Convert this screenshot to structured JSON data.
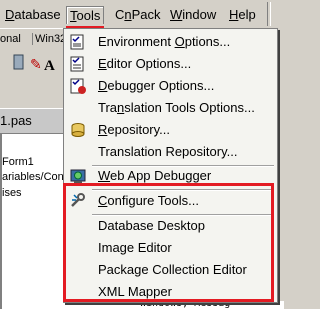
{
  "menubar": {
    "items": [
      {
        "label": "Database",
        "pre": "",
        "u": "D",
        "post": "atabase"
      },
      {
        "label": "Tools",
        "pre": "",
        "u": "T",
        "post": "ools"
      },
      {
        "label": "CnPack",
        "pre": "C",
        "u": "n",
        "post": "Pack"
      },
      {
        "label": "Window",
        "pre": "",
        "u": "W",
        "post": "indow"
      },
      {
        "label": "Help",
        "pre": "",
        "u": "H",
        "post": "elp"
      }
    ]
  },
  "background": {
    "tabs": [
      "onal",
      "Win32"
    ],
    "editor_tab": "1.pas",
    "editor_lines": [
      "Form1",
      "ariables/Cons",
      "ises"
    ],
    "bottom_text": "Windows, Messag"
  },
  "tools_menu": {
    "items": [
      {
        "pre": "Environment ",
        "u": "O",
        "post": "ptions...",
        "icon": "environment-options-icon"
      },
      {
        "pre": "",
        "u": "E",
        "post": "ditor Options...",
        "icon": "editor-options-icon"
      },
      {
        "pre": "",
        "u": "D",
        "post": "ebugger Options...",
        "icon": "debugger-options-icon"
      },
      {
        "pre": "Tra",
        "u": "n",
        "post": "slation Tools Options...",
        "icon": ""
      },
      {
        "pre": "",
        "u": "R",
        "post": "epository...",
        "icon": "repository-icon"
      },
      {
        "pre": "Translation Repository...",
        "u": "",
        "post": "",
        "icon": ""
      },
      {
        "pre": "",
        "u": "W",
        "post": "eb App Debugger",
        "icon": "web-app-debugger-icon"
      },
      {
        "pre": "",
        "u": "C",
        "post": "onfigure Tools...",
        "icon": "configure-tools-icon"
      },
      {
        "pre": "Database Desktop",
        "u": "",
        "post": "",
        "icon": ""
      },
      {
        "pre": "Image Editor",
        "u": "",
        "post": "",
        "icon": ""
      },
      {
        "pre": "Package Collection Editor",
        "u": "",
        "post": "",
        "icon": ""
      },
      {
        "pre": "XML Mapper",
        "u": "",
        "post": "",
        "icon": ""
      }
    ]
  },
  "colors": {
    "highlight": "#e31b23",
    "menu_bg": "#f4f4f0",
    "chrome": "#d4d0c8"
  }
}
